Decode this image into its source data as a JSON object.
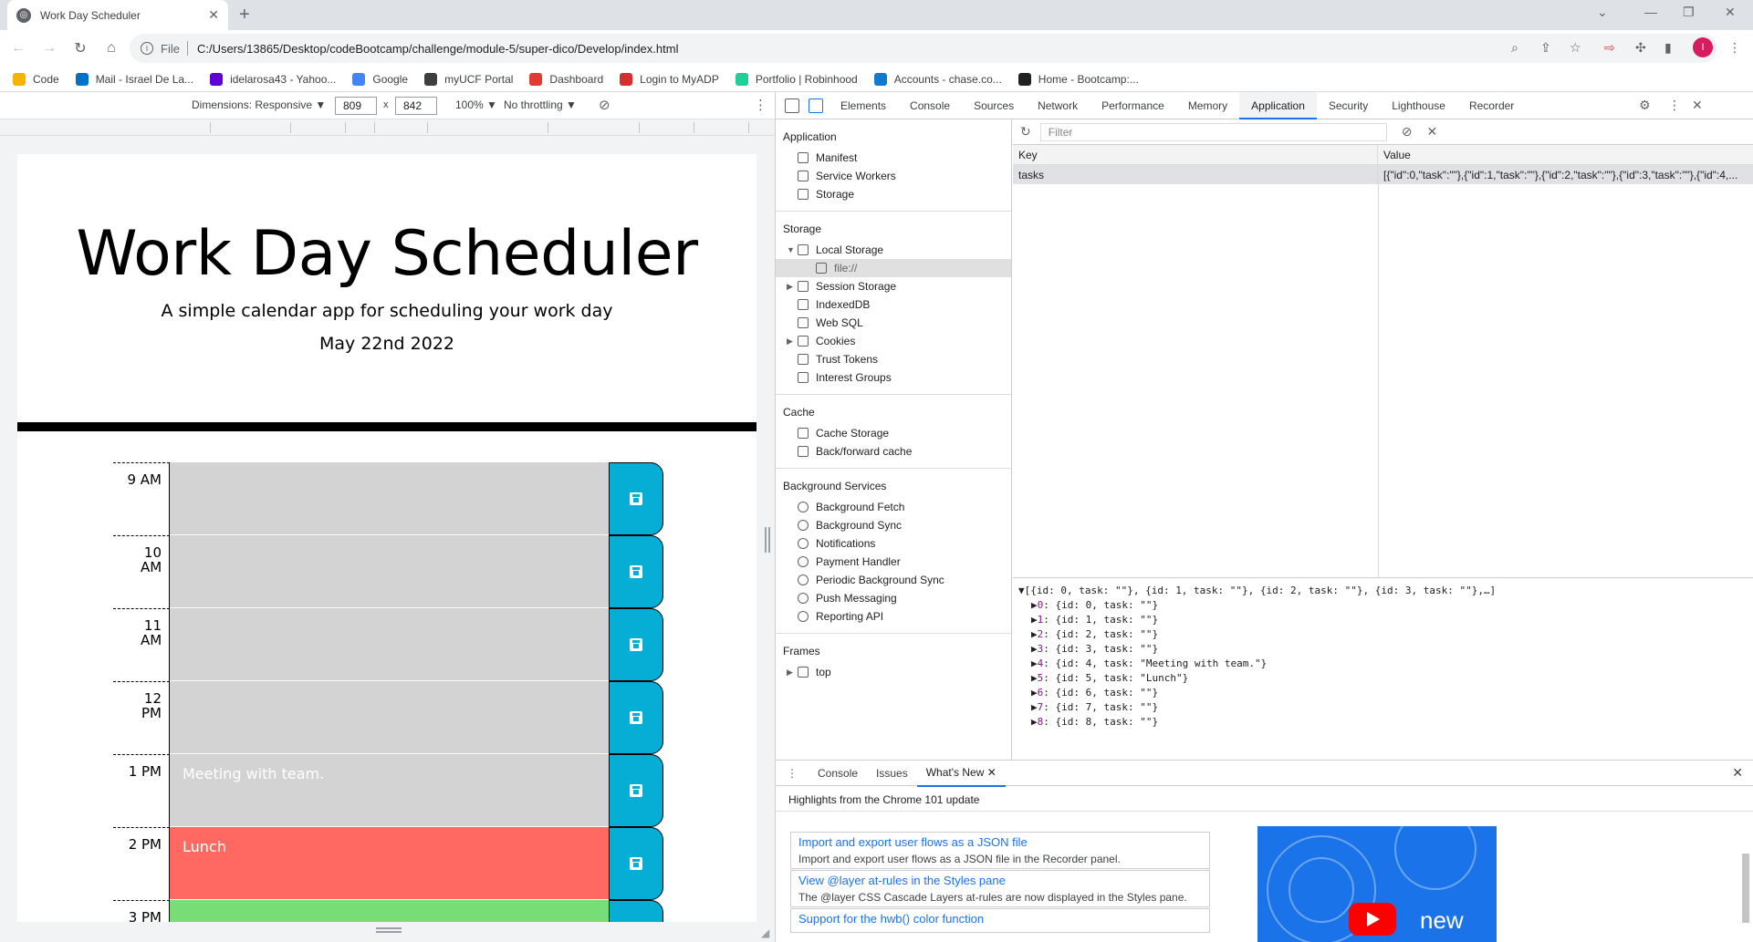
{
  "browser": {
    "tab_title": "Work Day Scheduler",
    "omnibox": {
      "scheme": "File",
      "url": "C:/Users/13865/Desktop/codeBootcamp/challenge/module-5/super-dico/Develop/index.html"
    },
    "bookmarks": [
      {
        "label": "Code",
        "color": "#f4b400"
      },
      {
        "label": "Mail - Israel De La...",
        "color": "#0072c6"
      },
      {
        "label": "idelarosa43 - Yahoo...",
        "color": "#6001d2"
      },
      {
        "label": "Google",
        "color": "#4285f4"
      },
      {
        "label": "myUCF Portal",
        "color": "#3c4043"
      },
      {
        "label": "Dashboard",
        "color": "#e53935"
      },
      {
        "label": "Login to MyADP",
        "color": "#d32f2f"
      },
      {
        "label": "Portfolio | Robinhood",
        "color": "#21ce99"
      },
      {
        "label": "Accounts - chase.co...",
        "color": "#117aca"
      },
      {
        "label": "Home - Bootcamp:...",
        "color": "#202124"
      }
    ],
    "profile_initial": "I"
  },
  "device_toolbar": {
    "dimensions": "Dimensions: Responsive ▼",
    "width": "809",
    "height": "842",
    "times": "x",
    "zoom": "100% ▼",
    "throttle": "No throttling ▼"
  },
  "page": {
    "title": "Work Day Scheduler",
    "lead": "A simple calendar app for scheduling your work day",
    "date": "May 22nd 2022",
    "rows": [
      {
        "hour": "9 AM",
        "task": "",
        "state": "past"
      },
      {
        "hour": "10 AM",
        "task": "",
        "state": "past"
      },
      {
        "hour": "11 AM",
        "task": "",
        "state": "past"
      },
      {
        "hour": "12 PM",
        "task": "",
        "state": "past"
      },
      {
        "hour": "1 PM",
        "task": "Meeting with team.",
        "state": "past"
      },
      {
        "hour": "2 PM",
        "task": "Lunch",
        "state": "present"
      },
      {
        "hour": "3 PM",
        "task": "",
        "state": "future"
      }
    ]
  },
  "devtools": {
    "tabs": [
      "Elements",
      "Console",
      "Sources",
      "Network",
      "Performance",
      "Memory",
      "Application",
      "Security",
      "Lighthouse",
      "Recorder"
    ],
    "active_tab": "Application",
    "sidebar": {
      "application": {
        "heading": "Application",
        "items": [
          "Manifest",
          "Service Workers",
          "Storage"
        ]
      },
      "storage": {
        "heading": "Storage",
        "local_storage": "Local Storage",
        "local_origin": "file://",
        "items": [
          "Session Storage",
          "IndexedDB",
          "Web SQL",
          "Cookies",
          "Trust Tokens",
          "Interest Groups"
        ]
      },
      "cache": {
        "heading": "Cache",
        "items": [
          "Cache Storage",
          "Back/forward cache"
        ]
      },
      "background": {
        "heading": "Background Services",
        "items": [
          "Background Fetch",
          "Background Sync",
          "Notifications",
          "Payment Handler",
          "Periodic Background Sync",
          "Push Messaging",
          "Reporting API"
        ]
      },
      "frames": {
        "heading": "Frames",
        "items": [
          "top"
        ]
      }
    },
    "filter_placeholder": "Filter",
    "table": {
      "key_header": "Key",
      "value_header": "Value",
      "row_key": "tasks",
      "row_value": "[{\"id\":0,\"task\":\"\"},{\"id\":1,\"task\":\"\"},{\"id\":2,\"task\":\"\"},{\"id\":3,\"task\":\"\"},{\"id\":4,..."
    },
    "preview": {
      "summary": "[{id: 0, task: \"\"}, {id: 1, task: \"\"}, {id: 2, task: \"\"}, {id: 3, task: \"\"},…]",
      "items": [
        {
          "idx": "0",
          "val": "{id: 0, task: \"\"}"
        },
        {
          "idx": "1",
          "val": "{id: 1, task: \"\"}"
        },
        {
          "idx": "2",
          "val": "{id: 2, task: \"\"}"
        },
        {
          "idx": "3",
          "val": "{id: 3, task: \"\"}"
        },
        {
          "idx": "4",
          "val": "{id: 4, task: \"Meeting with team.\"}"
        },
        {
          "idx": "5",
          "val": "{id: 5, task: \"Lunch\"}"
        },
        {
          "idx": "6",
          "val": "{id: 6, task: \"\"}"
        },
        {
          "idx": "7",
          "val": "{id: 7, task: \"\"}"
        },
        {
          "idx": "8",
          "val": "{id: 8, task: \"\"}"
        }
      ]
    },
    "drawer": {
      "tabs": [
        "Console",
        "Issues",
        "What's New"
      ],
      "active": "What's New",
      "highlights": "Highlights from the Chrome 101 update",
      "cards": [
        {
          "title": "Import and export user flows as a JSON file",
          "desc": "Import and export user flows as a JSON file in the Recorder panel."
        },
        {
          "title": "View @layer at-rules in the Styles pane",
          "desc": "The @layer CSS Cascade Layers at-rules are now displayed in the Styles pane."
        },
        {
          "title": "Support for the hwb() color function",
          "desc": ""
        }
      ],
      "promo_text": "new"
    }
  }
}
